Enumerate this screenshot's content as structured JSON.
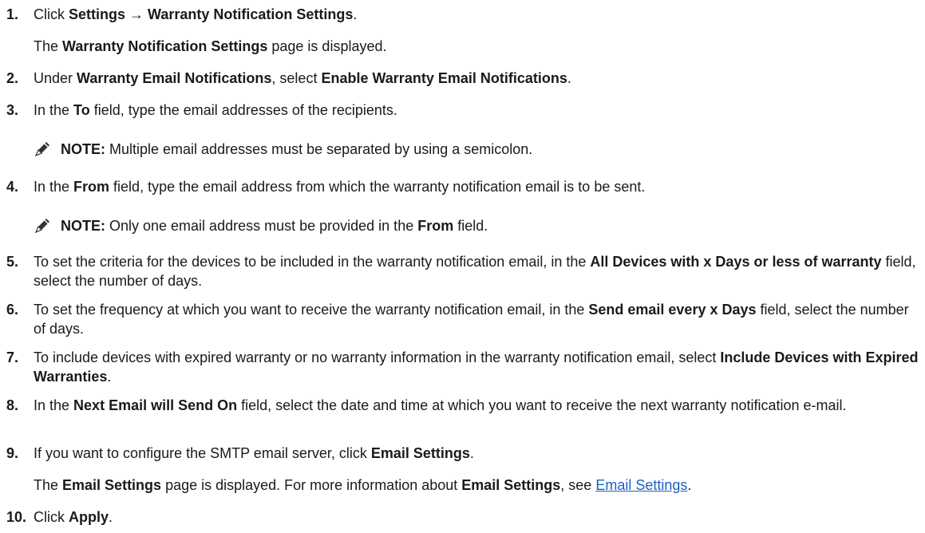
{
  "steps": [
    {
      "num": "1.",
      "parts": [
        {
          "t": "Click "
        },
        {
          "t": "Settings → Warranty Notification Settings",
          "b": true
        },
        {
          "t": "."
        }
      ],
      "result": [
        {
          "t": "The "
        },
        {
          "t": "Warranty Notification Settings",
          "b": true
        },
        {
          "t": " page is displayed."
        }
      ]
    },
    {
      "num": "2.",
      "parts": [
        {
          "t": "Under "
        },
        {
          "t": "Warranty Email Notifications",
          "b": true
        },
        {
          "t": ", select "
        },
        {
          "t": "Enable Warranty Email Notifications",
          "b": true
        },
        {
          "t": "."
        }
      ]
    },
    {
      "num": "3.",
      "parts": [
        {
          "t": "In the "
        },
        {
          "t": "To",
          "b": true
        },
        {
          "t": " field, type the email addresses of the recipients."
        }
      ],
      "note": [
        {
          "t": "NOTE:",
          "b": true
        },
        {
          "t": " Multiple email addresses must be separated by using a semicolon."
        }
      ]
    },
    {
      "num": "4.",
      "parts": [
        {
          "t": "In the "
        },
        {
          "t": "From",
          "b": true
        },
        {
          "t": " field, type the email address from which the warranty notification email is to be sent."
        }
      ],
      "note": [
        {
          "t": "NOTE:",
          "b": true
        },
        {
          "t": " Only one email address must be provided in the "
        },
        {
          "t": "From",
          "b": true
        },
        {
          "t": " field."
        }
      ]
    },
    {
      "num": "5.",
      "parts": [
        {
          "t": "To set the criteria for the devices to be included in the warranty notification email, in the "
        },
        {
          "t": "All Devices with x Days or less of warranty",
          "b": true
        },
        {
          "t": " field, select the number of days."
        }
      ]
    },
    {
      "num": "6.",
      "parts": [
        {
          "t": "To set the frequency at which you want to receive the warranty notification email, in the "
        },
        {
          "t": "Send email every x Days",
          "b": true
        },
        {
          "t": " field, select the number of days."
        }
      ]
    },
    {
      "num": "7.",
      "parts": [
        {
          "t": "To include devices with expired warranty or no warranty information in the warranty notification email, select "
        },
        {
          "t": "Include Devices with Expired Warranties",
          "b": true
        },
        {
          "t": "."
        }
      ]
    },
    {
      "num": "8.",
      "parts": [
        {
          "t": "In the "
        },
        {
          "t": "Next Email will Send On",
          "b": true
        },
        {
          "t": " field, select the date and time at which you want to receive the next warranty notification e-mail."
        }
      ]
    },
    {
      "num": "9.",
      "parts": [
        {
          "t": "If you want to configure the SMTP email server, click "
        },
        {
          "t": "Email Settings",
          "b": true
        },
        {
          "t": "."
        }
      ],
      "result": [
        {
          "t": "The "
        },
        {
          "t": "Email Settings",
          "b": true
        },
        {
          "t": " page is displayed. For more information about "
        },
        {
          "t": "Email Settings",
          "b": true
        },
        {
          "t": ", see "
        },
        {
          "t": "Email Settings",
          "link": true
        },
        {
          "t": "."
        }
      ]
    },
    {
      "num": "10.",
      "parts": [
        {
          "t": "Click "
        },
        {
          "t": "Apply",
          "b": true
        },
        {
          "t": "."
        }
      ]
    }
  ],
  "icons": {
    "note": "pencil-note-icon"
  },
  "colors": {
    "text": "#1a1a1a",
    "link": "#1f5fbf"
  }
}
